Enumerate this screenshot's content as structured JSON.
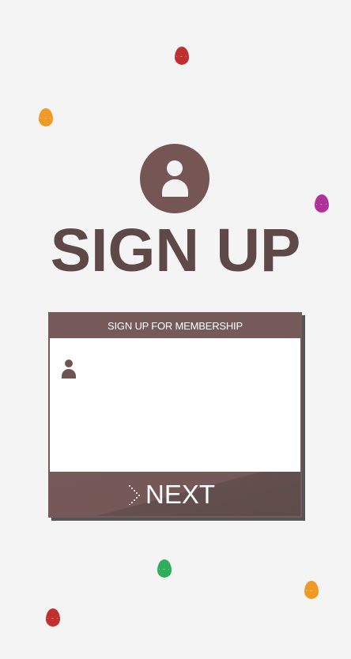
{
  "title": "SIGN UP",
  "card": {
    "header": "SIGN UP FOR MEMBERSHIP",
    "username_value": "",
    "next_label": "NEXT"
  },
  "eggs": [
    {
      "color": "#c0302f",
      "icon": "egg-icon",
      "face": "˙ᵕ˙"
    },
    {
      "color": "#f09a25",
      "icon": "egg-icon",
      "face": "˙ᵕ˙"
    },
    {
      "color": "#b1319b",
      "icon": "egg-icon",
      "face": "˙ᵕ˙"
    },
    {
      "color": "#2eae5a",
      "icon": "egg-icon",
      "face": "˙ᵕ˙"
    },
    {
      "color": "#f09a25",
      "icon": "egg-icon",
      "face": "˙ᵕ˙"
    },
    {
      "color": "#c0302f",
      "icon": "egg-icon",
      "face": "˙ᵕ˙"
    }
  ],
  "colors": {
    "brand": "#765a59",
    "title": "#5e4948",
    "background": "#f4f4f4"
  }
}
